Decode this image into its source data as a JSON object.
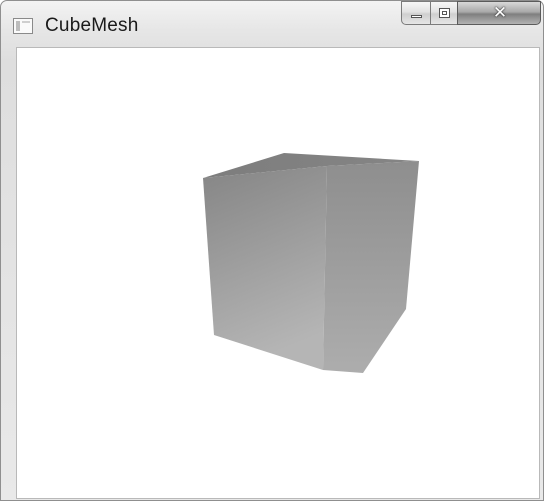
{
  "window": {
    "title": "CubeMesh",
    "app_icon": "window-app-icon",
    "caption_buttons": {
      "minimize_icon": "minimize-icon",
      "maximize_icon": "maximize-icon",
      "close_icon": "close-icon",
      "close_glyph": "✕"
    }
  },
  "scene": {
    "object": "cube-mesh",
    "face_colors": {
      "front_top": "#858585",
      "front_bottom": "#b5b5b5",
      "right_top": "#8e8e8e",
      "right_bottom": "#adadad",
      "top": "#7f7f7f"
    }
  }
}
